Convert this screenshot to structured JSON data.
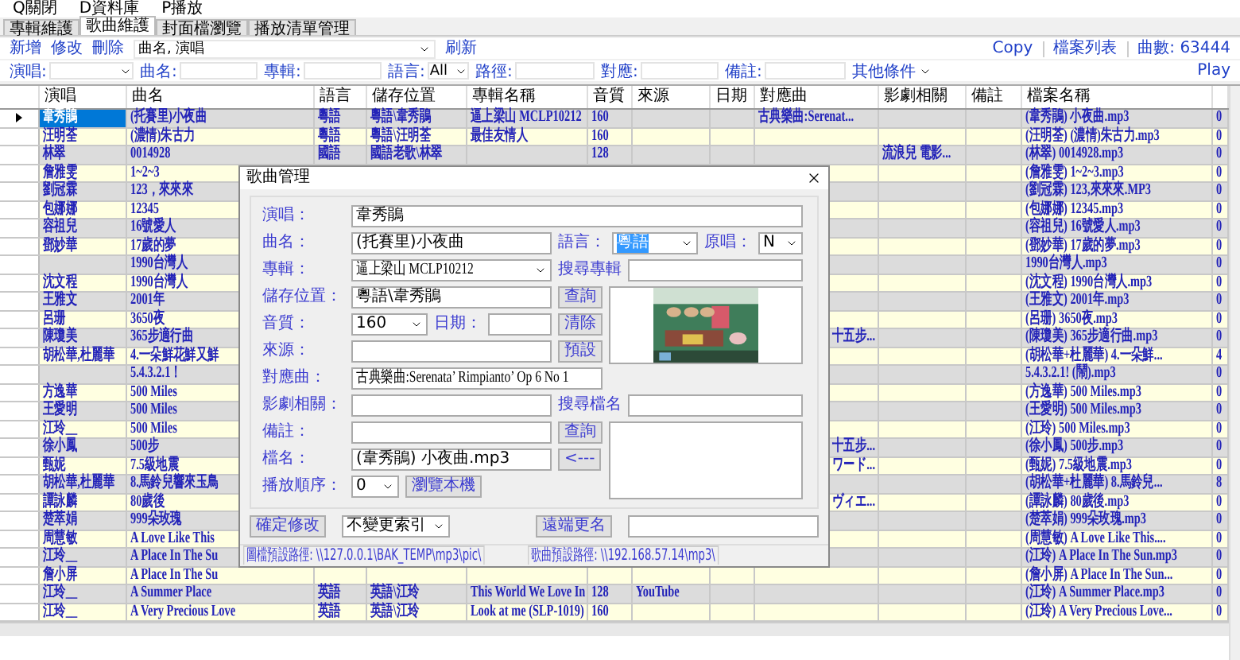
{
  "menu": [
    "Q關閉",
    "D資料庫",
    "P播放"
  ],
  "tabs": [
    {
      "label": "專輯維護",
      "selected": false
    },
    {
      "label": "歌曲維護",
      "selected": true
    },
    {
      "label": "封面檔瀏覽",
      "selected": false
    },
    {
      "label": "播放清單管理",
      "selected": false
    }
  ],
  "toolbar": {
    "buttons": [
      "新增",
      "修改",
      "刪除"
    ],
    "search_combo": "曲名, 演唱",
    "refresh": "刷新",
    "right": [
      "Copy",
      "檔案列表",
      "曲數: 63444"
    ]
  },
  "filters": [
    {
      "label": "演唱:",
      "kind": "combo"
    },
    {
      "label": "曲名:",
      "kind": "text"
    },
    {
      "label": "專輯:",
      "kind": "text"
    },
    {
      "label": "語言:",
      "kind": "combo",
      "value": "All"
    },
    {
      "label": "路徑:",
      "kind": "text"
    },
    {
      "label": "對應:",
      "kind": "text"
    },
    {
      "label": "備註:",
      "kind": "text"
    },
    {
      "label": "其他條件",
      "kind": "menu"
    }
  ],
  "play": "Play",
  "table": {
    "columns": [
      "演唱",
      "曲名",
      "語言",
      "儲存位置",
      "專輯名稱",
      "音質",
      "來源",
      "日期",
      "對應曲",
      "影劇相關",
      "備註",
      "檔案名稱"
    ],
    "rows": [
      {
        "selected": true,
        "singer": "韋秀鵑",
        "song": "(托賽里)小夜曲",
        "language": "粵語",
        "folder": "粵語\\韋秀鵑",
        "album": "逼上梁山 MCLP10212",
        "quality": "160",
        "matched": "古典樂曲:Serenat...",
        "file": "(韋秀鵑) 小夜曲.mp3",
        "count": "0"
      },
      {
        "selected": false,
        "singer": "汪明荃",
        "song": "(濃情)朱古力",
        "language": "粵語",
        "folder": "粵語\\汪明荃",
        "album": "最佳友情人",
        "quality": "160",
        "file": "(汪明荃) (濃情)朱古力.mp3",
        "count": "0"
      },
      {
        "selected": false,
        "singer": "林翠",
        "song": "0014928",
        "language": "國語",
        "folder": "國語老歌\\林翠",
        "quality": "128",
        "film": "流浪兒 電影...",
        "file": "(林翠) 0014928.mp3",
        "count": "0"
      },
      {
        "selected": false,
        "singer": "詹雅雯",
        "song": "1~2~3",
        "file": "(詹雅雯) 1~2~3.mp3",
        "count": "0"
      },
      {
        "selected": false,
        "singer": "劉冠霖",
        "song": "123，來來來",
        "file": "(劉冠霖) 123,來來來.MP3",
        "count": "0"
      },
      {
        "selected": false,
        "singer": "包娜娜",
        "song": "12345",
        "file": "(包娜娜) 12345.mp3",
        "count": "0"
      },
      {
        "selected": false,
        "singer": "容祖兒",
        "song": "16號愛人",
        "file": "(容祖兒) 16號愛人.mp3",
        "count": "0"
      },
      {
        "selected": false,
        "singer": "鄧妙華",
        "song": "17歲的夢",
        "file": "(鄧妙華) 17歲的夢.mp3",
        "count": "0"
      },
      {
        "selected": false,
        "song": "1990台灣人",
        "file": "1990台灣人.mp3",
        "count": "0"
      },
      {
        "selected": false,
        "singer": "沈文程",
        "song": "1990台灣人",
        "file": "(沈文程) 1990台灣人.mp3",
        "count": "0"
      },
      {
        "selected": false,
        "singer": "王雅文",
        "song": "2001年",
        "file": "(王雅文) 2001年.mp3",
        "count": "0"
      },
      {
        "selected": false,
        "singer": "呂珊",
        "song": "3650夜",
        "file": "(呂珊) 3650夜.mp3",
        "count": "0"
      },
      {
        "selected": false,
        "singer": "陳瓊美",
        "song": "365步適行曲",
        "matched": "十五步...",
        "matched_tail": true,
        "file": "(陳瓊美) 365步適行曲.mp3",
        "count": "0"
      },
      {
        "selected": false,
        "singer": "胡松華,杜麗華",
        "song": "4.一朵鮮花鮮又鮮",
        "file": "(胡松華+杜麗華) 4.一朵鮮...",
        "count": "4"
      },
      {
        "selected": false,
        "song": "5.4.3.2.1！",
        "file": "5.4.3.2.1! (鬧).mp3",
        "count": "0"
      },
      {
        "selected": false,
        "singer": "方逸華",
        "song": "500 Miles",
        "file": "(方逸華) 500 Miles.mp3",
        "count": "0"
      },
      {
        "selected": false,
        "singer": "王愛明",
        "song": "500 Miles",
        "file": "(王愛明) 500 Miles.mp3",
        "count": "0"
      },
      {
        "selected": false,
        "singer": "江玲__",
        "song": "500 Miles",
        "file": "(江玲) 500 Miles.mp3",
        "count": "0"
      },
      {
        "selected": false,
        "singer": "徐小鳳",
        "song": "500步",
        "matched": "十五步...",
        "matched_tail": true,
        "file": "(徐小鳳) 500步.mp3",
        "count": "0"
      },
      {
        "selected": false,
        "singer": "甄妮",
        "song": "7.5級地震",
        "matched": "ワード...",
        "matched_tail": true,
        "file": "(甄妮) 7.5級地震.mp3",
        "count": "0"
      },
      {
        "selected": false,
        "singer": "胡松華,杜麗華",
        "song": "8.馬鈴兒響來玉鳥",
        "file": "(胡松華+杜麗華) 8.馬鈴兒...",
        "count": "8"
      },
      {
        "selected": false,
        "singer": "譚詠麟",
        "song": "80歲後",
        "matched": "ヴィエ...",
        "matched_tail": true,
        "file": "(譚詠麟) 80歲後.mp3",
        "count": "0"
      },
      {
        "selected": false,
        "singer": "楚萃娟",
        "song": "999朵玫瑰",
        "file": "(楚萃娟) 999朵玫瑰.mp3",
        "count": "0"
      },
      {
        "selected": false,
        "singer": "周慧敏",
        "song": "A Love Like This",
        "file": "(周慧敏) A Love Like This....",
        "count": "0"
      },
      {
        "selected": false,
        "singer": "江玲__",
        "song": "A Place In The Su",
        "file": "(江玲) A Place In The Sun.mp3",
        "count": "0"
      },
      {
        "selected": false,
        "singer": "詹小屏",
        "song": "A Place In The Su",
        "file": "(詹小屏) A Place In The Sun...",
        "count": "0"
      },
      {
        "selected": false,
        "singer": "江玲__",
        "song": "A Summer Place",
        "language": "英語",
        "folder": "英語\\江玲",
        "album": "This World We Love In",
        "quality": "128",
        "source": "YouTube",
        "file": "(江玲) A Summer Place.mp3",
        "count": "0"
      },
      {
        "selected": false,
        "singer": "江玲__",
        "song": "A Very Precious Love",
        "language": "英語",
        "folder": "英語\\江玲",
        "album": "Look at me (SLP-1019)",
        "quality": "160",
        "file": "(江玲) A Very Precious Love...",
        "count": "0"
      }
    ]
  },
  "dialog": {
    "title": "歌曲管理",
    "singer": {
      "label": "演唱：",
      "value": "韋秀鵑"
    },
    "song": {
      "label": "曲名：",
      "value": "(托賽里)小夜曲"
    },
    "language": {
      "label": "語言：",
      "value": "粵語",
      "focused": true
    },
    "original": {
      "label": "原唱：",
      "value": "N"
    },
    "album": {
      "label": "專輯：",
      "value": "逼上梁山 MCLP10212"
    },
    "album_search": {
      "label": "搜尋專輯"
    },
    "folder": {
      "label": "儲存位置：",
      "value": "粵語\\韋秀鵑"
    },
    "quality": {
      "label": "音質：",
      "value": "160"
    },
    "date": {
      "label": "日期："
    },
    "source": {
      "label": "來源："
    },
    "matched": {
      "label": "對應曲：",
      "value": "古典樂曲:Serenata’ Rimpianto’ Op 6 No 1"
    },
    "film": {
      "label": "影劇相關："
    },
    "file_search": {
      "label": "搜尋檔名"
    },
    "note": {
      "label": "備註："
    },
    "filename": {
      "label": "檔名：",
      "value": "(韋秀鵑) 小夜曲.mp3"
    },
    "order": {
      "label": "播放順序：",
      "value": "0"
    },
    "buttons": {
      "query": "查詢",
      "clear": "清除",
      "preset": "預設",
      "query2": "查詢",
      "arrow": "<---",
      "browse": "瀏覽本機",
      "confirm": "確定修改",
      "rename": "遠端更名"
    },
    "index_mode": "不變更索引",
    "status": [
      "圖檔預設路徑: \\\\127.0.0.1\\BAK_TEMP\\mp3\\pic\\",
      "歌曲預設路徑: \\\\192.168.57.14\\mp3\\"
    ]
  }
}
